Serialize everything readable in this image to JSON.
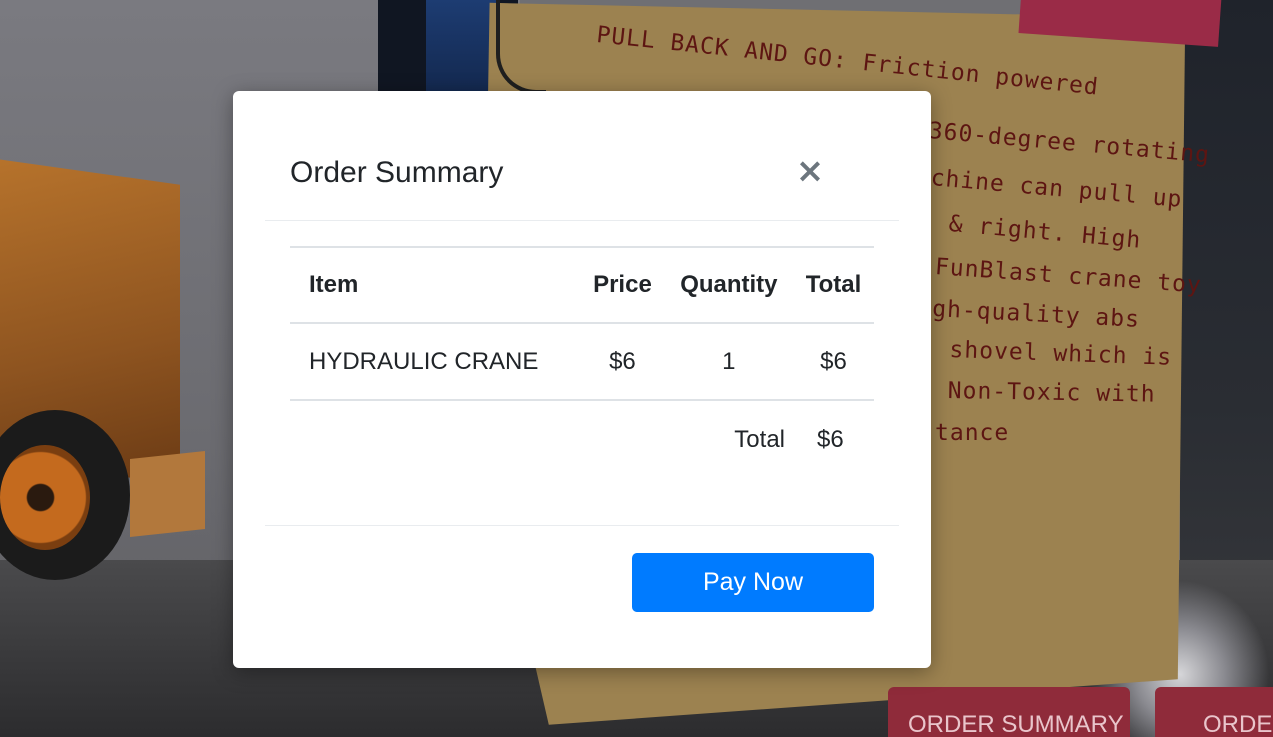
{
  "background": {
    "poster_lines": [
      "PULL BACK AND GO: Friction powered",
      "360-degree rotating",
      "chine can pull up",
      "& right. High",
      "FunBlast crane toy",
      "gh-quality abs",
      "shovel which is",
      "Non-Toxic with",
      "tance"
    ],
    "bottom_buttons": [
      "ORDER SUMMARY",
      "ORDER SUMMARY"
    ]
  },
  "modal": {
    "title": "Order Summary",
    "close_symbol": "×",
    "table": {
      "headers": [
        "Item",
        "Price",
        "Quantity",
        "Total"
      ],
      "rows": [
        {
          "item": "HYDRAULIC CRANE",
          "price": "$6",
          "quantity": "1",
          "total": "$6"
        }
      ],
      "grand_total_label": "Total",
      "grand_total_value": "$6"
    },
    "pay_button_label": "Pay Now"
  },
  "colors": {
    "primary": "#007bff",
    "ar_button": "#8f2b3a",
    "poster": "#9c8250",
    "poster_text": "#5d1512"
  },
  "icons": {
    "close": "close-icon"
  }
}
